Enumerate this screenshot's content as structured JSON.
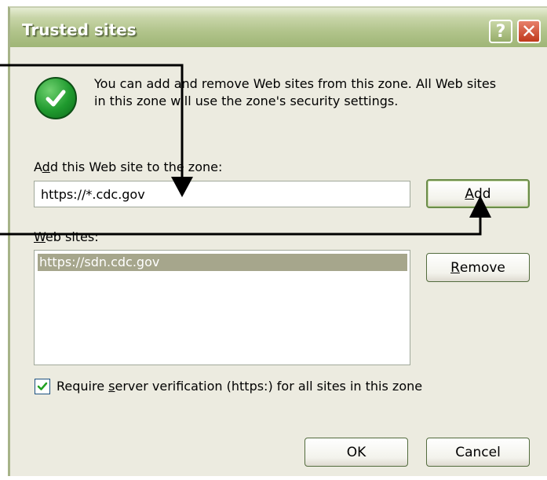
{
  "window": {
    "title": "Trusted sites"
  },
  "title_buttons": {
    "help": "?",
    "close": "✕"
  },
  "icons": {
    "info": "green-check-circle-icon",
    "checkbox_check": "checkmark-icon"
  },
  "info": {
    "line1": "You can add and remove Web sites from this zone. All Web sites",
    "line2": "in this zone will use the zone's security settings."
  },
  "add_site": {
    "label_a": "A",
    "label_u": "d",
    "label_b": "d this Web site to the zone:",
    "value": "https://*.cdc.gov",
    "add_button_u": "A",
    "add_button_rest": "dd"
  },
  "websites": {
    "label_u": "W",
    "label_rest": "eb sites:",
    "items": [
      "https://sdn.cdc.gov"
    ],
    "remove_button_u": "R",
    "remove_button_rest": "emove"
  },
  "verification": {
    "checked": true,
    "label_a": "Require ",
    "label_u": "s",
    "label_b": "erver verification (https:) for all sites in this zone"
  },
  "footer": {
    "ok_label": "OK",
    "cancel_label": "Cancel"
  },
  "colors": {
    "titlebar": "#b1c48b",
    "dialog_bg": "#ecebe0",
    "selection": "#a6a68c",
    "close": "#c0391c"
  }
}
